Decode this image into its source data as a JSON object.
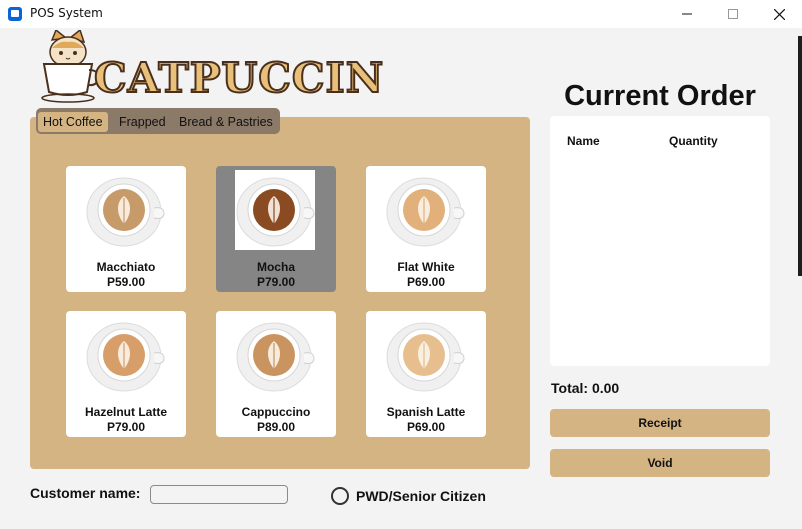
{
  "window": {
    "title": "POS System",
    "minimize_label": "minimize",
    "maximize_label": "maximize",
    "close_label": "close"
  },
  "brand": {
    "name": "CATPUCCINO",
    "colors": {
      "text": "#e8c07a",
      "outline": "#4a2f1d",
      "cat": "#e0a85a"
    }
  },
  "tabs": [
    {
      "label": "Hot Coffee",
      "active": true
    },
    {
      "label": "Frapped",
      "active": false
    },
    {
      "label": "Bread & Pastries",
      "active": false
    }
  ],
  "menu_items": [
    {
      "name": "Macchiato",
      "price": "P59.00",
      "selected": false,
      "image_icon": "coffee-cup-latte-art-icon"
    },
    {
      "name": "Mocha",
      "price": "P79.00",
      "selected": true,
      "image_icon": "coffee-cup-latte-art-icon"
    },
    {
      "name": "Flat White",
      "price": "P69.00",
      "selected": false,
      "image_icon": "coffee-cup-latte-art-icon"
    },
    {
      "name": "Hazelnut Latte",
      "price": "P79.00",
      "selected": false,
      "image_icon": "coffee-cup-latte-art-icon"
    },
    {
      "name": "Cappuccino",
      "price": "P89.00",
      "selected": false,
      "image_icon": "coffee-cup-latte-art-icon"
    },
    {
      "name": "Spanish Latte",
      "price": "P69.00",
      "selected": false,
      "image_icon": "coffee-cup-latte-art-icon"
    }
  ],
  "order": {
    "title": "Current Order",
    "columns": [
      "Name",
      "Quantity"
    ],
    "rows": [],
    "total_label": "Total: 0.00"
  },
  "actions": {
    "receipt_label": "Receipt",
    "void_label": "Void"
  },
  "customer": {
    "label": "Customer name:",
    "value": "",
    "placeholder": ""
  },
  "discount": {
    "label": "PWD/Senior Citizen",
    "checked": false
  },
  "colors": {
    "accent": "#d4b483",
    "tab_bar": "#8c7a69",
    "selected_card": "#858585",
    "background": "#f3f3f3"
  }
}
